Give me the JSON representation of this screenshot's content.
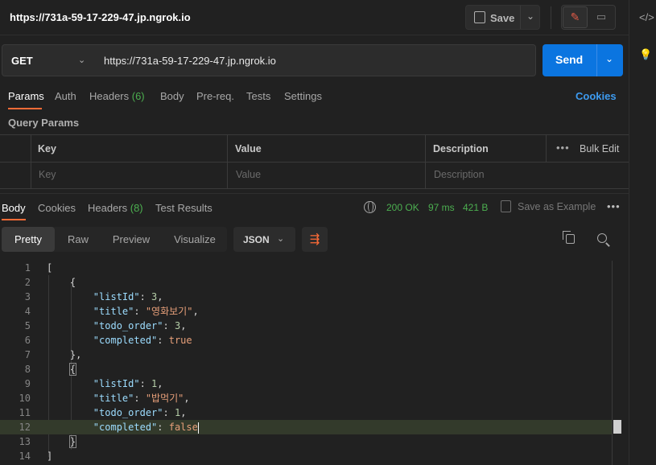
{
  "header": {
    "title": "https://731a-59-17-229-47.jp.ngrok.io",
    "save_label": "Save"
  },
  "request": {
    "method": "GET",
    "url": "https://731a-59-17-229-47.jp.ngrok.io",
    "send_label": "Send",
    "tabs": [
      {
        "label": "Params"
      },
      {
        "label": "Auth"
      },
      {
        "label": "Headers ",
        "badge": "(6)"
      },
      {
        "label": "Body"
      },
      {
        "label": "Pre-req."
      },
      {
        "label": "Tests"
      },
      {
        "label": "Settings"
      }
    ],
    "cookies_label": "Cookies",
    "query_params_title": "Query Params",
    "params_table": {
      "headers": [
        "Key",
        "Value",
        "Description"
      ],
      "placeholders": [
        "Key",
        "Value",
        "Description"
      ],
      "bulk_edit_label": "Bulk Edit"
    }
  },
  "response": {
    "tabs": [
      {
        "label": "Body"
      },
      {
        "label": "Cookies"
      },
      {
        "label": "Headers ",
        "badge": "(8)"
      },
      {
        "label": "Test Results"
      }
    ],
    "status": "200 OK",
    "time": "97 ms",
    "size": "421 B",
    "save_example_label": "Save as Example",
    "formats": [
      "Pretty",
      "Raw",
      "Preview",
      "Visualize"
    ],
    "language": "JSON",
    "line_numbers": [
      "1",
      "2",
      "3",
      "4",
      "5",
      "6",
      "7",
      "8",
      "9",
      "10",
      "11",
      "12",
      "13",
      "14"
    ]
  },
  "colors": {
    "accent": "#ff6c37",
    "send": "#0b75e0",
    "status_ok": "#4caf50",
    "link": "#3d9bf0"
  }
}
